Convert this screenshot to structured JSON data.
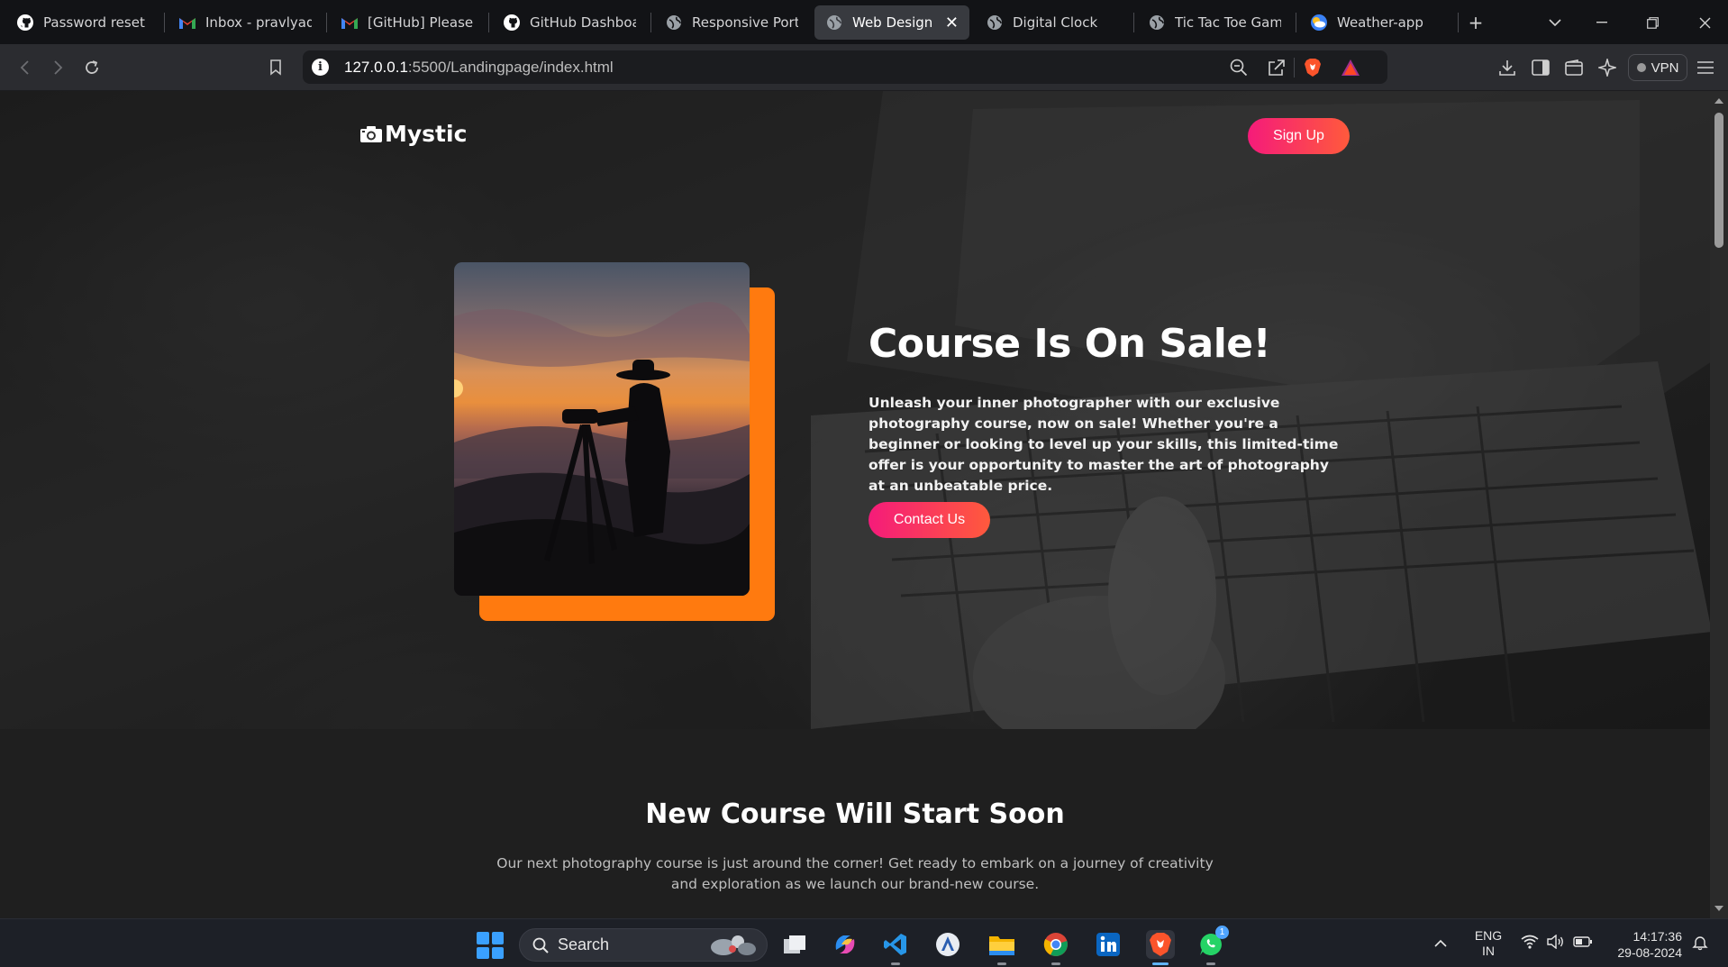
{
  "browser": {
    "tabs": [
      {
        "title": "Password reset se",
        "icon": "github-icon"
      },
      {
        "title": "Inbox - pravlyada",
        "icon": "gmail-icon"
      },
      {
        "title": "[GitHub] Please re",
        "icon": "gmail-icon"
      },
      {
        "title": "GitHub Dashboard",
        "icon": "github-icon"
      },
      {
        "title": "Responsive Portfo",
        "icon": "globe-icon"
      },
      {
        "title": "Web Design I",
        "icon": "globe-icon",
        "active": true
      },
      {
        "title": "Digital Clock",
        "icon": "globe-icon"
      },
      {
        "title": "Tic Tac Toe Game",
        "icon": "globe-icon"
      },
      {
        "title": "Weather-app",
        "icon": "weather-icon"
      }
    ],
    "url_host": "127.0.0.1",
    "url_path": ":5500/Landingpage/index.html",
    "vpn_label": "VPN"
  },
  "page": {
    "logo_text": "Mystic",
    "signup_label": "Sign Up",
    "hero_title": "Course Is On Sale!",
    "hero_text": "Unleash your inner photographer with our exclusive photography course, now on sale! Whether you're a beginner or looking to level up your skills, this limited-time offer is your opportunity to master the art of photography at an unbeatable price.",
    "contact_label": "Contact Us",
    "section2_title": "New Course Will Start Soon",
    "section2_text": "Our next photography course is just around the corner! Get ready to embark on a journey of creativity and exploration as we launch our brand-new course."
  },
  "taskbar": {
    "search_label": "Search",
    "whatsapp_badge": "1",
    "lang_line1": "ENG",
    "lang_line2": "IN",
    "time": "14:17:36",
    "date": "29-08-2024"
  },
  "colors": {
    "accent_gradient_start": "#f51b7a",
    "accent_gradient_end": "#ff5a3c",
    "photo_frame": "#ff7a0f"
  }
}
